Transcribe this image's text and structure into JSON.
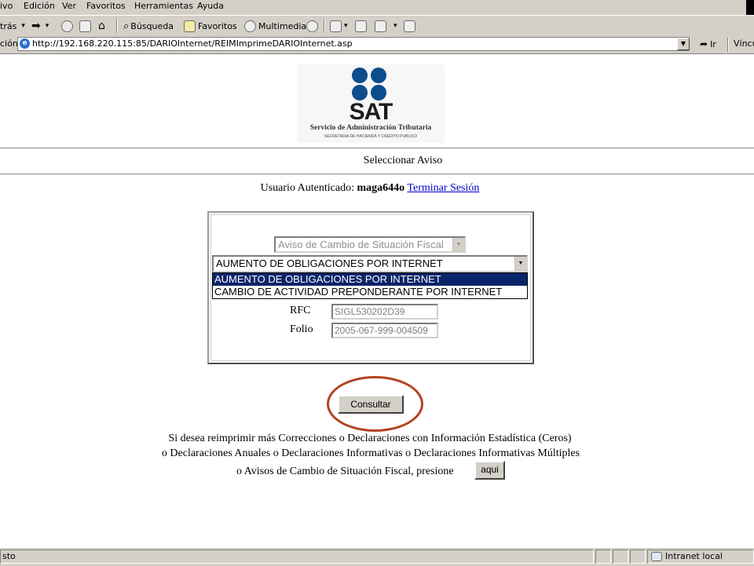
{
  "browser": {
    "menu": [
      "ivo",
      "Edición",
      "Ver",
      "Favoritos",
      "Herramientas",
      "Ayuda"
    ],
    "toolbar": {
      "back_label": "trás",
      "search_label": "Búsqueda",
      "favorites_label": "Favoritos",
      "multimedia_label": "Multimedia"
    },
    "address": {
      "label": "ción",
      "url": "http://192.168.220.115:85/DARIOInternet/REIMImprimeDARIOInternet.asp",
      "go_label": "Ir",
      "links_label": "Víncu"
    },
    "status": {
      "text": "sto",
      "zone": "Intranet local"
    }
  },
  "page": {
    "logo": {
      "word": "SAT",
      "subtitle": "Servicio de Administración Tributaria",
      "subsubtitle": "SECRETARIA DE HACIENDA Y CREDITO PUBLICO"
    },
    "section_title": "Seleccionar Aviso",
    "auth": {
      "prefix": "Usuario Autenticado:",
      "user": "maga644o",
      "logout_link": "Terminar Sesión"
    },
    "form": {
      "aviso_type_selected": "Aviso de Cambio de Situación Fiscal",
      "obligation_selected": "AUMENTO DE OBLIGACIONES POR INTERNET",
      "obligation_options": [
        "AUMENTO DE OBLIGACIONES POR INTERNET",
        "CAMBIO DE ACTIVIDAD PREPONDERANTE POR INTERNET"
      ],
      "rfc_label": "RFC",
      "rfc_value": "SIGL530202D39",
      "folio_label": "Folio",
      "folio_value": "2005-067-999-004509",
      "submit_label": "Consultar"
    },
    "footer": {
      "line1": "Si desea reimprimir más Correcciones o Declaraciones con Información Estadística (Ceros)",
      "line2": "o Declaraciones Anuales o Declaraciones Informativas o Declaraciones Informativas Múltiples",
      "line3": "o Avisos de Cambio de Situación Fiscal, presione",
      "button_label": "aqui"
    }
  },
  "colors": {
    "chrome": "#d4d0c8",
    "highlight": "#0a246a",
    "logo_blue": "#0c4e8b",
    "link": "#0000cc",
    "annotation_ring": "#b2441f"
  }
}
